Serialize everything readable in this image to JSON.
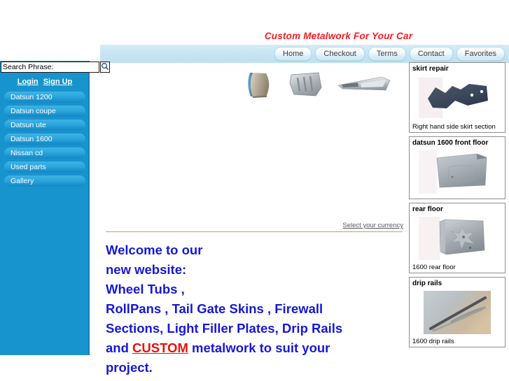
{
  "header": {
    "title": "Custom Metalwork For Your Car",
    "title_color": "#fc1921",
    "nav_items": [
      {
        "label": "Home"
      },
      {
        "label": "Checkout"
      },
      {
        "label": "Terms"
      },
      {
        "label": "Contact"
      },
      {
        "label": "Favorites"
      }
    ]
  },
  "sidebar": {
    "background_color": "#1794ce",
    "search": {
      "value": "Search Phrase:",
      "placeholder": "Search Phrase:",
      "button_icon": "search-icon"
    },
    "account": {
      "login_label": "Login",
      "signup_label": "Sign Up"
    },
    "items": [
      {
        "label": "Datsun 1200"
      },
      {
        "label": "Datsun coupe"
      },
      {
        "label": "Datsun ute"
      },
      {
        "label": "Datsun 1600"
      },
      {
        "label": "Nissan cd"
      },
      {
        "label": "Used parts"
      },
      {
        "label": "Gallery"
      }
    ]
  },
  "main": {
    "currency_link": "Select your currency",
    "rule_color": "#f08a6e",
    "welcome": {
      "line1": "Welcome to our",
      "line2": "new website:",
      "line3": "Wheel Tubs ,",
      "line4": "RollPans ,  Tail Gate Skins , Firewall",
      "line5": "Sections, Light Filler Plates, Drip Rails",
      "line6_before": "and  ",
      "line6_custom": "CUSTOM",
      "line6_after": " metalwork to suit your",
      "line7": "project.",
      "text_color": "#1618d8",
      "custom_color": "#e8120b"
    },
    "hero_images": [
      {
        "name": "wheel-tub-thumbnail"
      },
      {
        "name": "firewall-section-thumbnail"
      },
      {
        "name": "light-filler-plate-thumbnail"
      }
    ]
  },
  "products": [
    {
      "title": "skirt repair",
      "caption": "Right hand side skirt section",
      "image_name": "skirt-repair-image"
    },
    {
      "title": "datsun 1600 front floor",
      "caption": "",
      "image_name": "front-floor-image"
    },
    {
      "title": "rear floor",
      "caption": "1600 rear floor",
      "image_name": "rear-floor-image"
    },
    {
      "title": "drip rails",
      "caption": "1600 drip rails",
      "image_name": "drip-rails-image"
    }
  ]
}
